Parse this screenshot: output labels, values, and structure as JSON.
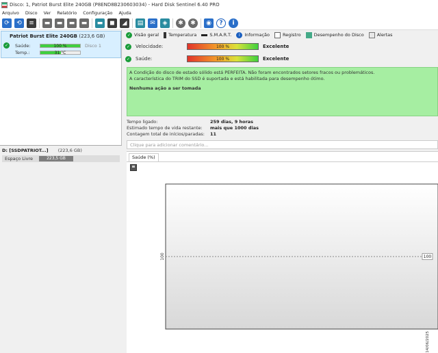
{
  "window": {
    "title": "Disco: 1, Patriot Burst Elite 240GB (P8END8B230603034)  -  Hard Disk Sentinel 6.40 PRO"
  },
  "menu": [
    "Arquivo",
    "Disco",
    "Ver",
    "Relatório",
    "Configuração",
    "Ajuda"
  ],
  "toolbar_icons": [
    "refresh-icon",
    "refresh-all-icon",
    "list-icon",
    "disk-icon",
    "disk-check-icon",
    "disk-schedule-icon",
    "disk-tools-icon",
    "disk-remove-icon",
    "disk-blue-icon",
    "chat-icon",
    "mail-icon",
    "report-icon",
    "settings-icon",
    "options-icon",
    "camera-icon",
    "help-icon",
    "info-icon"
  ],
  "disk": {
    "name": "Patriot Burst Elite 240GB",
    "size": "(223,6 GB)",
    "health_label": "Saúde:",
    "health_value": "100 %",
    "health_pct": 100,
    "disk_ref": "Disco 1",
    "temp_label": "Temp.:",
    "temp_value": "31 °C",
    "temp_pct": 52
  },
  "partition": {
    "name": "D: [SSDPATRIOT...]",
    "size": "(223,6 GB)",
    "free_label": "Espaço Livre",
    "free_value": "223,5 GB"
  },
  "tabs": [
    {
      "label": "Visão geral",
      "icon": "overview-icon"
    },
    {
      "label": "Temperatura",
      "icon": "thermometer-icon"
    },
    {
      "label": "S.M.A.R.T.",
      "icon": "smart-icon"
    },
    {
      "label": "Informação",
      "icon": "info-icon"
    },
    {
      "label": "Registro",
      "icon": "log-icon"
    },
    {
      "label": "Desempenho do Disco",
      "icon": "performance-icon"
    },
    {
      "label": "Alertas",
      "icon": "alert-icon"
    }
  ],
  "overview": {
    "performance_label": "Velocidade:",
    "performance_value": "100 %",
    "performance_verdict": "Excelente",
    "health_label": "Saúde:",
    "health_value": "100 %",
    "health_verdict": "Excelente",
    "message_line1": "A Condição do disco de estado sólido está PERFEITA. Não foram encontrados setores fracos ou problemáticos.",
    "message_line2": "A característica do TRIM do SSD é suportada e está habilitada para desempenho ótimo.",
    "action": "Nenhuma ação a ser tomada"
  },
  "stats": [
    {
      "key": "Tempo ligado:",
      "value": "259 dias, 9 horas"
    },
    {
      "key": "Estimado tempo de vida restante:",
      "value": "mais que 1000 dias"
    },
    {
      "key": "Contagem total de inícios/paradas:",
      "value": "11"
    }
  ],
  "comment_placeholder": "Clique para adicionar  comentário...",
  "chart_tab": "Saúde (%)",
  "chart_data": {
    "type": "line",
    "title": "",
    "xlabel": "",
    "ylabel": "",
    "x": [
      "14/06/2025"
    ],
    "series": [
      {
        "values": [
          100
        ]
      }
    ],
    "y_tick": "100",
    "point_label": "100"
  }
}
